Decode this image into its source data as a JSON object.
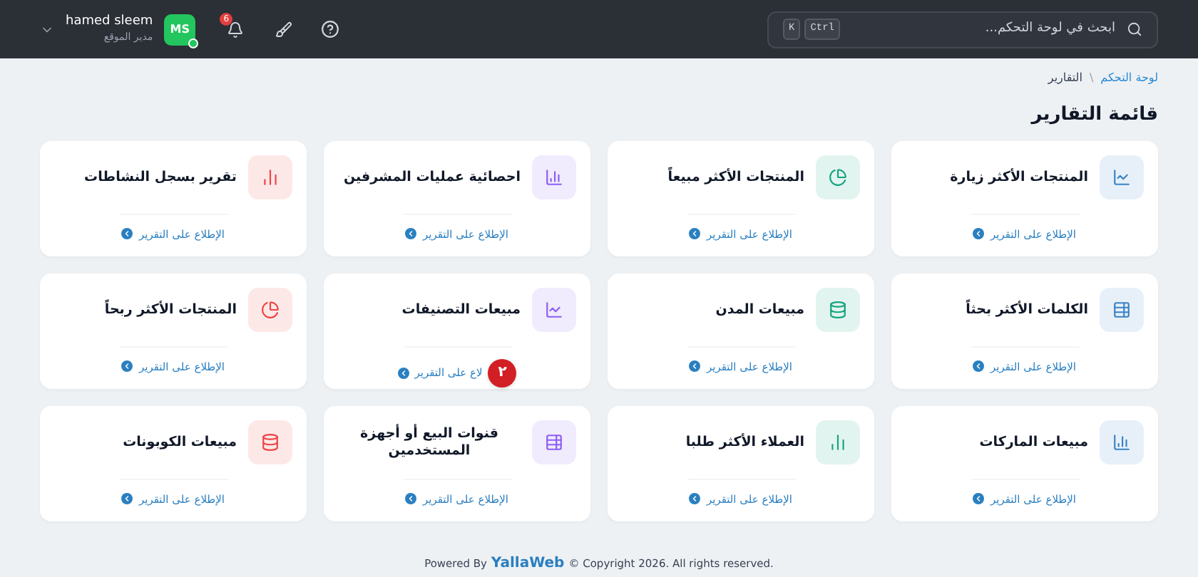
{
  "topbar": {
    "search": {
      "placeholder": "ابحث في لوحة التحكم...",
      "keys": [
        "Ctrl",
        "K"
      ]
    },
    "notifications": {
      "count": "6"
    },
    "user": {
      "initials": "MS",
      "online": true,
      "name": "hamed sleem",
      "role": "مدير الموقع"
    }
  },
  "breadcrumb": [
    {
      "label": "لوحة التحكم",
      "selected": false
    },
    {
      "label": "التقارير",
      "selected": true
    }
  ],
  "breadcrumb_separator": "\\",
  "page_title": "قائمة التقارير",
  "cards": [
    {
      "title": "المنتجات الأكثر زيارة",
      "link": "الإطلاع على التقرير",
      "color": "#3b82c4"
    },
    {
      "title": "المنتجات الأكثر مبيعاً",
      "link": "الإطلاع على التقرير",
      "color": "#14a37f"
    },
    {
      "title": "احصائية عمليات المشرفين",
      "link": "الإطلاع على التقرير",
      "color": "#8b5cf6"
    },
    {
      "title": "تقرير بسجل النشاطات",
      "link": "الإطلاع على التقرير",
      "color": "#ef4444"
    },
    {
      "title": "الكلمات الأكثر بحثاً",
      "link": "الإطلاع على التقرير",
      "color": "#3b82c4"
    },
    {
      "title": "مبيعات المدن",
      "link": "الإطلاع على التقرير",
      "color": "#14a37f"
    },
    {
      "title": "مبيعات التصنيفات",
      "link": "لاع على التقرير",
      "color": "#8b5cf6",
      "badge": "٢"
    },
    {
      "title": "المنتجات الأكثر ربحاً",
      "link": "الإطلاع على التقرير",
      "color": "#ef4444"
    },
    {
      "title": "مبيعات الماركات",
      "link": "الإطلاع على التقرير",
      "color": "#3b82c4"
    },
    {
      "title": "العملاء الأكثر طلبا",
      "link": "الإطلاع على التقرير",
      "color": "#14a37f"
    },
    {
      "title": "قنوات البيع أو أجهزة المستخدمين",
      "link": "الإطلاع على التقرير",
      "color": "#8b5cf6"
    },
    {
      "title": "مبيعات الكوبونات",
      "link": "الإطلاع على التقرير",
      "color": "#ef4444"
    }
  ],
  "footer": {
    "prefix": "Powered By",
    "brand": "YallaWeb",
    "suffix": "© Copyright 2026. All rights reserved."
  }
}
